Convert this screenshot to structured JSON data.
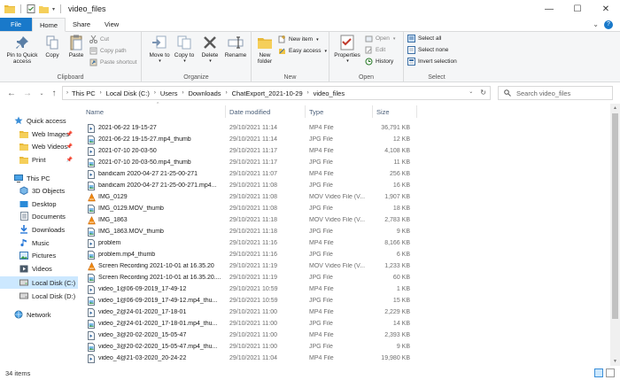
{
  "window": {
    "title": "video_files",
    "controls": [
      "—",
      "☐",
      "✕"
    ]
  },
  "tabs": {
    "file": "File",
    "home": "Home",
    "share": "Share",
    "view": "View"
  },
  "ribbon": {
    "clipboard": {
      "label": "Clipboard",
      "pin": "Pin to Quick access",
      "copy": "Copy",
      "paste": "Paste",
      "cut": "Cut",
      "copy_path": "Copy path",
      "paste_shortcut": "Paste shortcut"
    },
    "organize": {
      "label": "Organize",
      "move_to": "Move to",
      "copy_to": "Copy to",
      "delete": "Delete",
      "rename": "Rename"
    },
    "new": {
      "label": "New",
      "new_folder": "New folder",
      "new_item": "New item",
      "easy_access": "Easy access"
    },
    "open": {
      "label": "Open",
      "properties": "Properties",
      "open": "Open",
      "edit": "Edit",
      "history": "History"
    },
    "select": {
      "label": "Select",
      "select_all": "Select all",
      "select_none": "Select none",
      "invert": "Invert selection"
    }
  },
  "address": {
    "crumbs": [
      "This PC",
      "Local Disk (C:)",
      "Users",
      "Downloads",
      "ChatExport_2021-10-29",
      "video_files"
    ],
    "search_placeholder": "Search video_files"
  },
  "nav": {
    "quick_access": "Quick access",
    "pinned": [
      "Web Images",
      "Web Videos",
      "Print"
    ],
    "this_pc": "This PC",
    "pc_items": [
      "3D Objects",
      "Desktop",
      "Documents",
      "Downloads",
      "Music",
      "Pictures",
      "Videos",
      "Local Disk (C:)",
      "Local Disk (D:)"
    ],
    "network": "Network"
  },
  "columns": {
    "name": "Name",
    "date": "Date modified",
    "type": "Type",
    "size": "Size"
  },
  "files": [
    {
      "name": "2021-06-22 19-15-27",
      "date": "29/10/2021 11:14",
      "type": "MP4 File",
      "size": "36,791 KB",
      "kind": "mp4"
    },
    {
      "name": "2021-06-22 19-15-27.mp4_thumb",
      "date": "29/10/2021 11:14",
      "type": "JPG File",
      "size": "12 KB",
      "kind": "jpg"
    },
    {
      "name": "2021-07-10 20-03-50",
      "date": "29/10/2021 11:17",
      "type": "MP4 File",
      "size": "4,108 KB",
      "kind": "mp4"
    },
    {
      "name": "2021-07-10 20-03-50.mp4_thumb",
      "date": "29/10/2021 11:17",
      "type": "JPG File",
      "size": "11 KB",
      "kind": "jpg"
    },
    {
      "name": "bandicam 2020-04-27 21-25-00-271",
      "date": "29/10/2021 11:07",
      "type": "MP4 File",
      "size": "256 KB",
      "kind": "mp4"
    },
    {
      "name": "bandicam 2020-04-27 21-25-00-271.mp4...",
      "date": "29/10/2021 11:08",
      "type": "JPG File",
      "size": "16 KB",
      "kind": "jpg"
    },
    {
      "name": "IMG_0129",
      "date": "29/10/2021 11:08",
      "type": "MOV Video File (V...",
      "size": "1,907 KB",
      "kind": "mov"
    },
    {
      "name": "IMG_0129.MOV_thumb",
      "date": "29/10/2021 11:08",
      "type": "JPG File",
      "size": "18 KB",
      "kind": "jpg"
    },
    {
      "name": "IMG_1863",
      "date": "29/10/2021 11:18",
      "type": "MOV Video File (V...",
      "size": "2,783 KB",
      "kind": "mov"
    },
    {
      "name": "IMG_1863.MOV_thumb",
      "date": "29/10/2021 11:18",
      "type": "JPG File",
      "size": "9 KB",
      "kind": "jpg"
    },
    {
      "name": "problem",
      "date": "29/10/2021 11:16",
      "type": "MP4 File",
      "size": "8,166 KB",
      "kind": "mp4"
    },
    {
      "name": "problem.mp4_thumb",
      "date": "29/10/2021 11:16",
      "type": "JPG File",
      "size": "6 KB",
      "kind": "jpg"
    },
    {
      "name": "Screen Recording 2021-10-01 at 16.35.20",
      "date": "29/10/2021 11:19",
      "type": "MOV Video File (V...",
      "size": "1,233 KB",
      "kind": "mov"
    },
    {
      "name": "Screen Recording 2021-10-01 at 16.35.20....",
      "date": "29/10/2021 11:19",
      "type": "JPG File",
      "size": "60 KB",
      "kind": "jpg"
    },
    {
      "name": "video_1@06-09-2019_17-49-12",
      "date": "29/10/2021 10:59",
      "type": "MP4 File",
      "size": "1 KB",
      "kind": "mp4"
    },
    {
      "name": "video_1@06-09-2019_17-49-12.mp4_thu...",
      "date": "29/10/2021 10:59",
      "type": "JPG File",
      "size": "15 KB",
      "kind": "jpg"
    },
    {
      "name": "video_2@24-01-2020_17-18-01",
      "date": "29/10/2021 11:00",
      "type": "MP4 File",
      "size": "2,229 KB",
      "kind": "mp4"
    },
    {
      "name": "video_2@24-01-2020_17-18-01.mp4_thu...",
      "date": "29/10/2021 11:00",
      "type": "JPG File",
      "size": "14 KB",
      "kind": "jpg"
    },
    {
      "name": "video_3@20-02-2020_15-05-47",
      "date": "29/10/2021 11:00",
      "type": "MP4 File",
      "size": "2,393 KB",
      "kind": "mp4"
    },
    {
      "name": "video_3@20-02-2020_15-05-47.mp4_thu...",
      "date": "29/10/2021 11:00",
      "type": "JPG File",
      "size": "9 KB",
      "kind": "jpg"
    },
    {
      "name": "video_4@21-03-2020_20-24-22",
      "date": "29/10/2021 11:04",
      "type": "MP4 File",
      "size": "19,980 KB",
      "kind": "mp4"
    }
  ],
  "status": {
    "items": "34 items"
  },
  "colors": {
    "accent": "#1979ca",
    "selected_nav": "#cce8ff",
    "header_text": "#4c607a"
  }
}
